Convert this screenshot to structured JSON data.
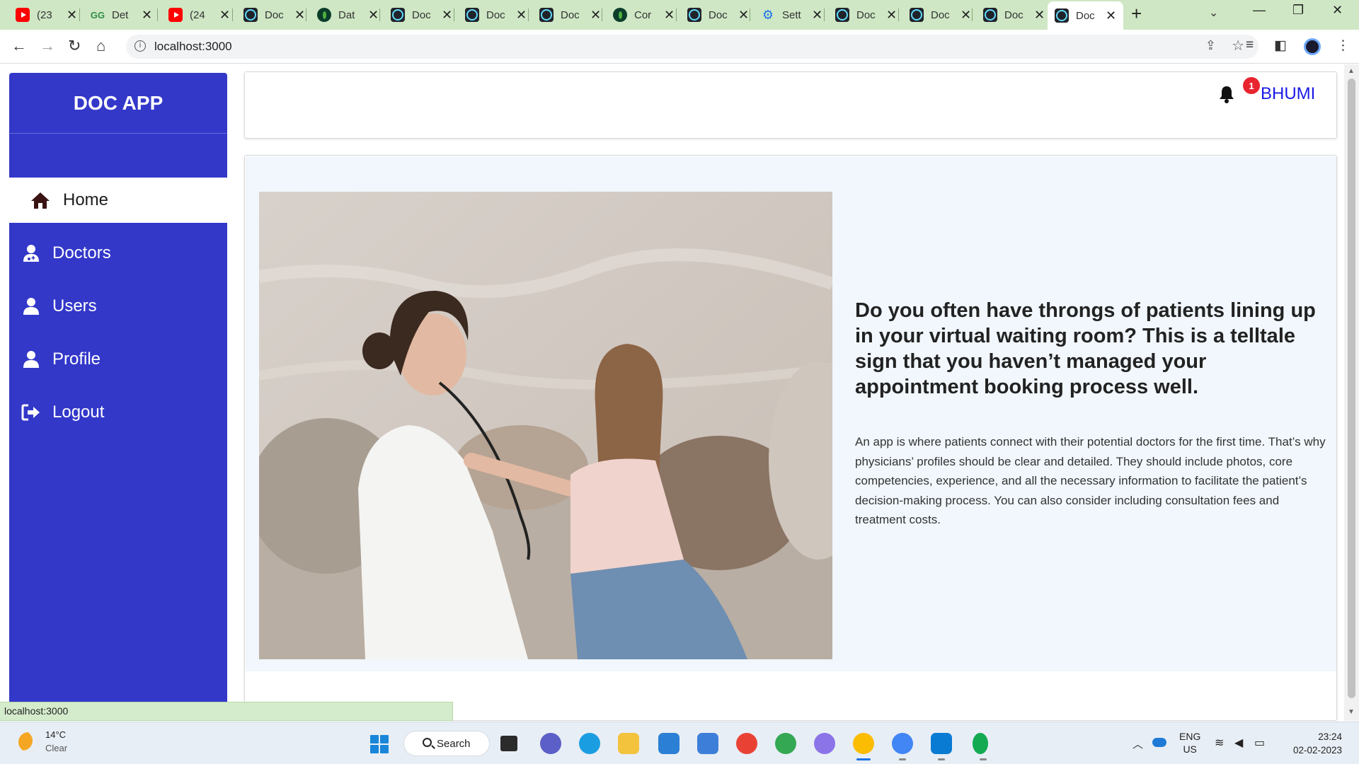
{
  "browser": {
    "tabs": [
      {
        "title": "(23",
        "icon": "youtube-icon"
      },
      {
        "title": "Det",
        "icon": "geeksforgeeks-icon"
      },
      {
        "title": "(24",
        "icon": "youtube-icon"
      },
      {
        "title": "Doc",
        "icon": "react-icon"
      },
      {
        "title": "Dat",
        "icon": "mongodb-icon"
      },
      {
        "title": "Doc",
        "icon": "react-icon"
      },
      {
        "title": "Doc",
        "icon": "react-icon"
      },
      {
        "title": "Doc",
        "icon": "react-icon"
      },
      {
        "title": "Cor",
        "icon": "mongodb-icon"
      },
      {
        "title": "Doc",
        "icon": "react-icon"
      },
      {
        "title": "Sett",
        "icon": "settings-gear-icon"
      },
      {
        "title": "Doc",
        "icon": "react-icon"
      },
      {
        "title": "Doc",
        "icon": "react-icon"
      },
      {
        "title": "Doc",
        "icon": "react-icon"
      },
      {
        "title": "Doc",
        "icon": "react-icon",
        "active": true
      }
    ],
    "url": "localhost:3000",
    "status_url": "localhost:3000"
  },
  "app": {
    "brand": "DOC APP",
    "menu": [
      {
        "label": "Home",
        "icon": "home-icon",
        "active": true
      },
      {
        "label": "Doctors",
        "icon": "user-doctor-icon"
      },
      {
        "label": "Users",
        "icon": "user-icon"
      },
      {
        "label": "Profile",
        "icon": "user-icon"
      },
      {
        "label": "Logout",
        "icon": "logout-icon"
      }
    ],
    "header": {
      "notification_count": "1",
      "username": "BHUMI"
    },
    "hero": {
      "title": "Do you often have throngs of patients lining up in your virtual waiting room? This is a telltale sign that you haven’t managed your appointment booking process well.",
      "body": "An app is where patients connect with their potential doctors for the first time. That’s why physicians’ profiles should be clear and detailed. They should include photos, core competencies, experience, and all the necessary information to facilitate the patient’s decision-making process. You can also consider including consultation fees and treatment costs."
    }
  },
  "taskbar": {
    "weather": {
      "temp": "14°C",
      "condition": "Clear"
    },
    "search_label": "Search",
    "language": {
      "lang": "ENG",
      "region": "US"
    },
    "clock": {
      "time": "23:24",
      "date": "02-02-2023"
    }
  },
  "colors": {
    "sidebar": "#3338c9",
    "hero_bg": "#f1f7fc",
    "username": "#1a1ae6",
    "badge": "#e8242f",
    "tabstrip": "#cfe7c4"
  }
}
